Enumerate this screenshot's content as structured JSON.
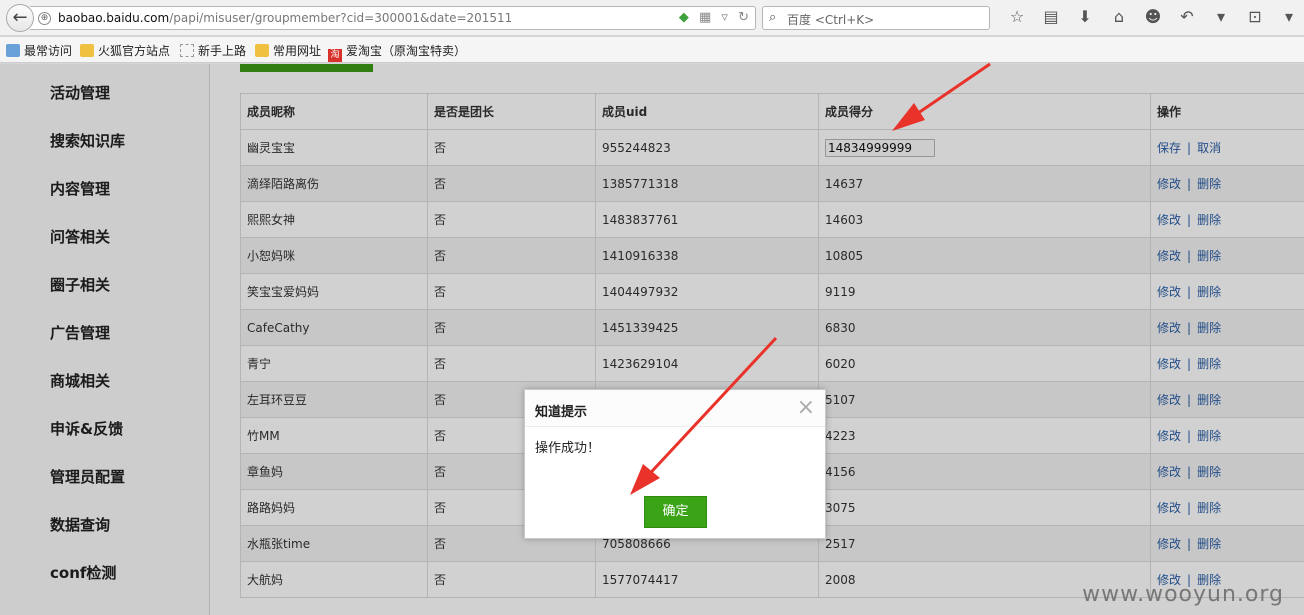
{
  "browser": {
    "url_host": "baobao.baidu.com",
    "url_path": "/papi/misuser/groupmember?cid=300001&date=201511",
    "search_placeholder": "百度 <Ctrl+K>",
    "bookmarks": [
      {
        "label": "最常访问",
        "icon": "blue"
      },
      {
        "label": "火狐官方站点",
        "icon": "folder"
      },
      {
        "label": "新手上路",
        "icon": "blank"
      },
      {
        "label": "常用网址",
        "icon": "folder"
      },
      {
        "label": "爱淘宝（原淘宝特卖）",
        "icon": "tao"
      }
    ],
    "tao_icon_text": "淘"
  },
  "sidebar": {
    "items": [
      "活动管理",
      "搜索知识库",
      "内容管理",
      "问答相关",
      "圈子相关",
      "广告管理",
      "商城相关",
      "申诉&反馈",
      "管理员配置",
      "数据查询",
      "conf检测"
    ]
  },
  "table": {
    "headers": [
      "成员昵称",
      "是否是团长",
      "成员uid",
      "成员得分",
      "操作"
    ],
    "edit_row": {
      "nickname": "幽灵宝宝",
      "leader": "否",
      "uid": "955244823",
      "score_input": "14834999999",
      "save": "保存",
      "cancel": "取消",
      "sep": "|"
    },
    "rows": [
      {
        "nickname": "滴绎陌路离伤",
        "leader": "否",
        "uid": "1385771318",
        "score": "14637"
      },
      {
        "nickname": "熙熙女神",
        "leader": "否",
        "uid": "1483837761",
        "score": "14603"
      },
      {
        "nickname": "小恕妈咪",
        "leader": "否",
        "uid": "1410916338",
        "score": "10805"
      },
      {
        "nickname": "笑宝宝爱妈妈",
        "leader": "否",
        "uid": "1404497932",
        "score": "9119"
      },
      {
        "nickname": "CafeCathy",
        "leader": "否",
        "uid": "1451339425",
        "score": "6830"
      },
      {
        "nickname": "青宁",
        "leader": "否",
        "uid": "1423629104",
        "score": "6020"
      },
      {
        "nickname": "左耳环豆豆",
        "leader": "否",
        "uid": "",
        "score": "5107"
      },
      {
        "nickname": "竹MM",
        "leader": "否",
        "uid": "",
        "score": "4223"
      },
      {
        "nickname": "章鱼妈",
        "leader": "否",
        "uid": "",
        "score": "4156"
      },
      {
        "nickname": "路路妈妈",
        "leader": "否",
        "uid": "",
        "score": "3075"
      },
      {
        "nickname": "水瓶张time",
        "leader": "否",
        "uid": "705808666",
        "score": "2517"
      },
      {
        "nickname": "大航妈",
        "leader": "否",
        "uid": "1577074417",
        "score": "2008"
      }
    ],
    "edit_label": "修改",
    "delete_label": "删除",
    "sep": "|"
  },
  "dialog": {
    "title": "知道提示",
    "message": "操作成功！",
    "ok": "确定"
  },
  "watermark": "www.wooyun.org",
  "colors": {
    "accent_green": "#3aa316",
    "link_blue": "#2a5ea8",
    "arrow_red": "#e8322a"
  }
}
